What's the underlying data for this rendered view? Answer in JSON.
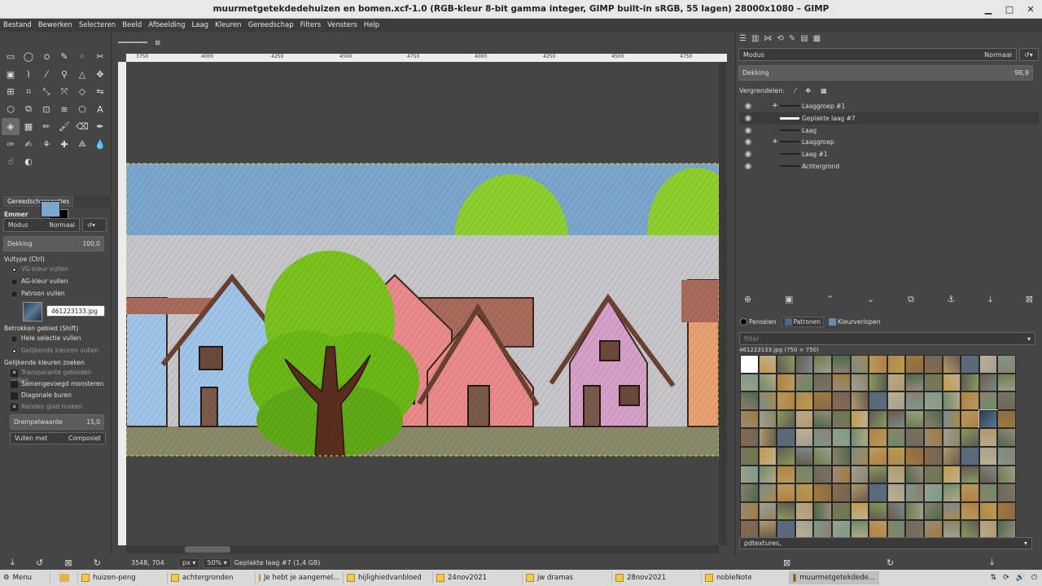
{
  "window": {
    "title": "muurmetgetekdedehuizen en bomen.xcf-1.0 (RGB-kleur 8-bit gamma integer, GIMP built-in sRGB, 55 lagen) 28000x1080 – GIMP"
  },
  "menu": [
    "Bestand",
    "Bewerken",
    "Selecteren",
    "Beeld",
    "Afbeelding",
    "Laag",
    "Kleuren",
    "Gereedschap",
    "Filters",
    "Vensters",
    "Help"
  ],
  "tool_options": {
    "tab_label": "Gereedschapsopties",
    "tool_name": "Emmer",
    "mode_label": "Modus",
    "mode_value": "Normaal",
    "opacity_label": "Dekking",
    "opacity_value": "100,0",
    "fill_type_label": "Vultype (Ctrl)",
    "fill_fg": "VG-kleur vullen",
    "fill_bg": "AG-kleur vullen",
    "fill_pattern": "Patroon vullen",
    "pattern_name": "461223133.jpg",
    "area_label": "Betrokken gebied (Shift)",
    "area_selection": "Hele selectie vullen",
    "area_similar": "Gelijkende kleuren vullen",
    "similar_label": "Gelijkende kleuren zoeken",
    "transparent": "Transparante gebieden vullen",
    "merged": "Samengevoegd monsteren",
    "diagonal": "Diagonale buren",
    "antialias": "Randen glad maken",
    "threshold_label": "Drempelwaarde",
    "threshold_value": "15,0",
    "fill_by_label": "Vullen met",
    "fill_by_value": "Composiet"
  },
  "ruler": {
    "ticks": [
      "3750",
      "4000",
      "4250",
      "4500",
      "4750",
      "4000",
      "4250",
      "4500",
      "4750"
    ]
  },
  "status": {
    "coords": "3548, 704",
    "unit": "px",
    "zoom": "50%",
    "info": "Geplakte laag #7 (1,4 GB)"
  },
  "layers_panel": {
    "mode_label": "Modus",
    "mode_value": "Normaal",
    "opacity_label": "Dekking",
    "opacity_value": "98,9",
    "lock_label": "Vergrendelen:",
    "layers": [
      {
        "name": "Laaggroep #1",
        "group": true
      },
      {
        "name": "Geplakte laag #7",
        "group": false,
        "selected": true
      },
      {
        "name": "Laag",
        "group": false
      },
      {
        "name": "Laaggroep",
        "group": true
      },
      {
        "name": "Laag #1",
        "group": false
      },
      {
        "name": "Achtergrond",
        "group": false
      }
    ]
  },
  "patterns_panel": {
    "tabs": [
      "Penselen",
      "Patronen",
      "Kleurverlopen"
    ],
    "filter_placeholder": "filter",
    "selected_info": "461223133.jpg (750 × 750)",
    "tag_value": "pdtextures,"
  },
  "taskbar": {
    "menu_label": "Menu",
    "tasks": [
      "huizen-peng",
      "achtergronden",
      "Je hebt je aangemel...",
      "hijlighiedvanbloed",
      "24nov2021",
      "jw dramas",
      "28nov2021",
      "nobleNote",
      "muurmetgetekdede..."
    ]
  }
}
